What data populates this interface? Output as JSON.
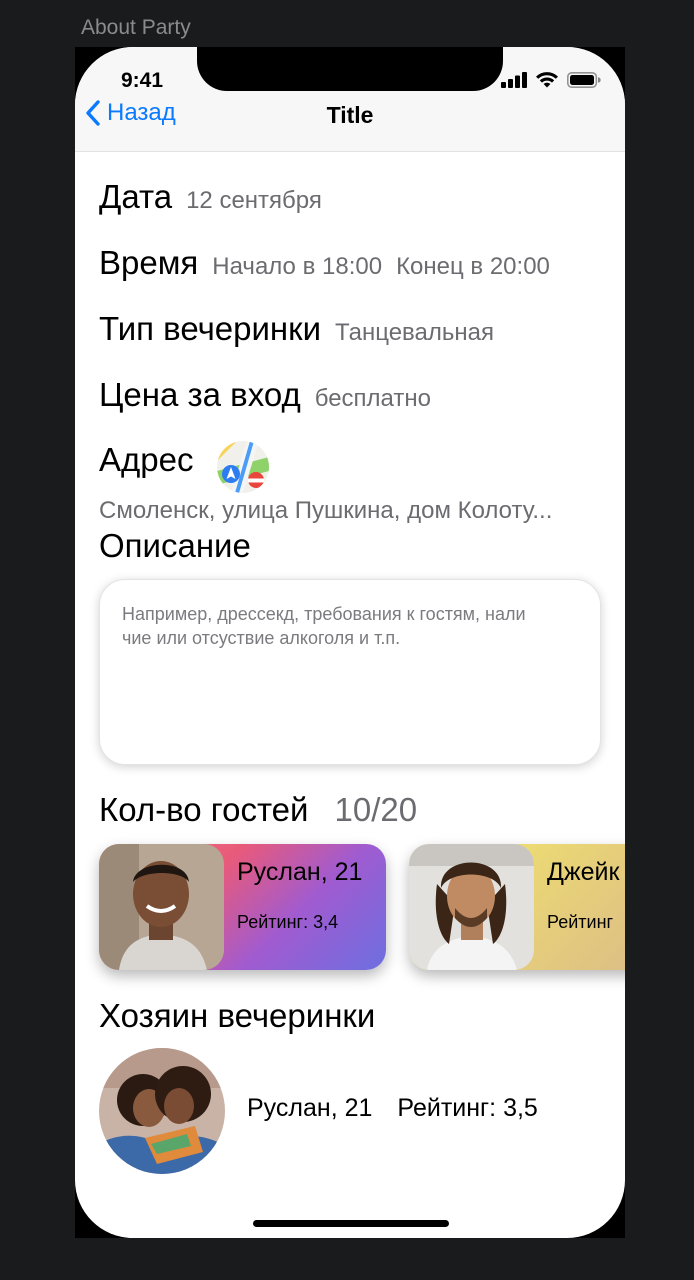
{
  "frame_label": "About Party",
  "status_bar": {
    "time": "9:41"
  },
  "navbar": {
    "back_label": "Назад",
    "title": "Title"
  },
  "details": {
    "date": {
      "label": "Дата",
      "value": "12 сентября"
    },
    "time": {
      "label": "Время",
      "start": "Начало в 18:00",
      "end": "Конец в 20:00"
    },
    "type": {
      "label": "Тип вечеринки",
      "value": "Танцевальная"
    },
    "price": {
      "label": "Цена за вход",
      "value": "бесплатно"
    },
    "address": {
      "label": "Адрес",
      "value": "Смоленск, улица Пушкина, дом Колоту..."
    }
  },
  "description": {
    "label": "Описание",
    "placeholder_line1": "Например, дрессекд, требования к гостям, нали",
    "placeholder_line2": "чие или отсуствие алкоголя и т.п."
  },
  "guests": {
    "label": "Кол-во гостей",
    "count": "10/20",
    "items": [
      {
        "name": "Руслан, 21",
        "rating": "Рейтинг: 3,4"
      },
      {
        "name": "Джейк",
        "rating": "Рейтинг"
      }
    ]
  },
  "host": {
    "label": "Хозяин вечеринки",
    "name": "Руслан, 21",
    "rating": "Рейтинг: 3,5"
  },
  "colors": {
    "accent": "#0a7aff",
    "secondary_text": "#6c6c70",
    "background": "#1a1b1d"
  }
}
